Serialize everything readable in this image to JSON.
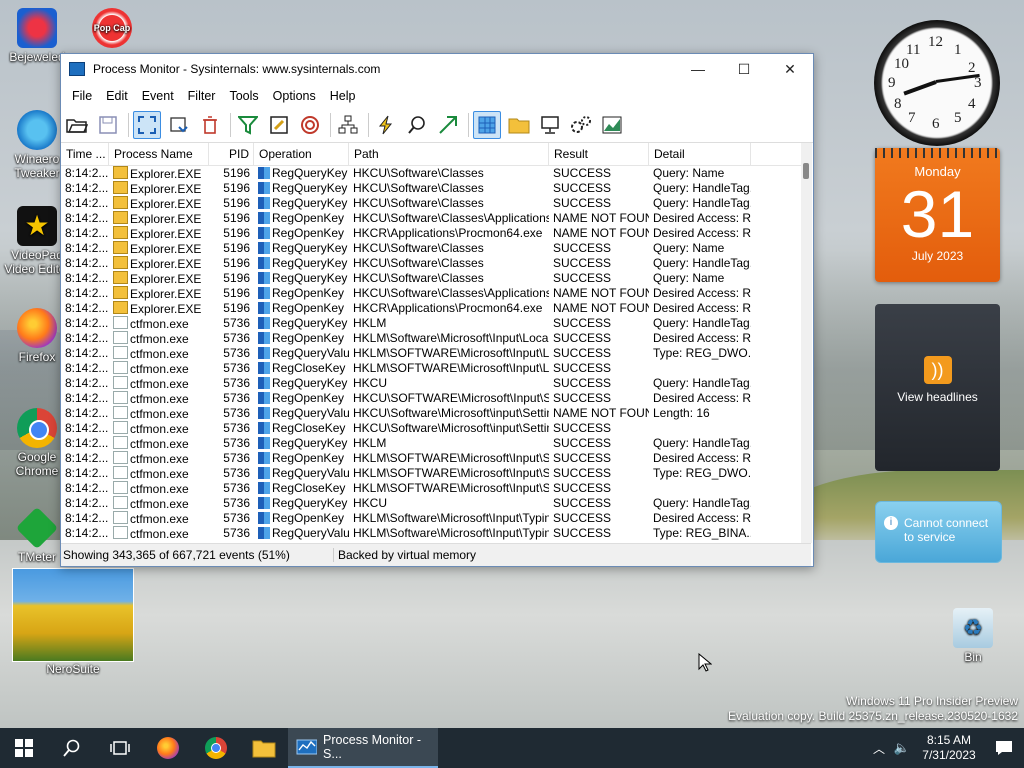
{
  "desktop": {
    "icons": [
      {
        "label": "Bejeweled"
      },
      {
        "label": "Winaero Tweaker"
      },
      {
        "label": "VideoPad Video Editor"
      },
      {
        "label": "Firefox"
      },
      {
        "label": "Google Chrome"
      },
      {
        "label": "TMeter"
      },
      {
        "label": "NeroSuite"
      },
      {
        "label": "Bin"
      }
    ],
    "popcap_label": "Pop Cap"
  },
  "window": {
    "title": "Process Monitor - Sysinternals: www.sysinternals.com",
    "menu": [
      "File",
      "Edit",
      "Event",
      "Filter",
      "Tools",
      "Options",
      "Help"
    ],
    "columns": [
      "Time ...",
      "Process Name",
      "PID",
      "Operation",
      "Path",
      "Result",
      "Detail"
    ],
    "rows": [
      [
        "8:14:2...",
        "Explorer.EXE",
        "5196",
        "RegQueryKey",
        "HKCU\\Software\\Classes",
        "SUCCESS",
        "Query: Name"
      ],
      [
        "8:14:2...",
        "Explorer.EXE",
        "5196",
        "RegQueryKey",
        "HKCU\\Software\\Classes",
        "SUCCESS",
        "Query: HandleTag..."
      ],
      [
        "8:14:2...",
        "Explorer.EXE",
        "5196",
        "RegQueryKey",
        "HKCU\\Software\\Classes",
        "SUCCESS",
        "Query: HandleTag..."
      ],
      [
        "8:14:2...",
        "Explorer.EXE",
        "5196",
        "RegOpenKey",
        "HKCU\\Software\\Classes\\Applications\\...",
        "NAME NOT FOUND",
        "Desired Access: R..."
      ],
      [
        "8:14:2...",
        "Explorer.EXE",
        "5196",
        "RegOpenKey",
        "HKCR\\Applications\\Procmon64.exe",
        "NAME NOT FOUND",
        "Desired Access: R..."
      ],
      [
        "8:14:2...",
        "Explorer.EXE",
        "5196",
        "RegQueryKey",
        "HKCU\\Software\\Classes",
        "SUCCESS",
        "Query: Name"
      ],
      [
        "8:14:2...",
        "Explorer.EXE",
        "5196",
        "RegQueryKey",
        "HKCU\\Software\\Classes",
        "SUCCESS",
        "Query: HandleTag..."
      ],
      [
        "8:14:2...",
        "Explorer.EXE",
        "5196",
        "RegQueryKey",
        "HKCU\\Software\\Classes",
        "SUCCESS",
        "Query: Name"
      ],
      [
        "8:14:2...",
        "Explorer.EXE",
        "5196",
        "RegOpenKey",
        "HKCU\\Software\\Classes\\Applications\\...",
        "NAME NOT FOUND",
        "Desired Access: R..."
      ],
      [
        "8:14:2...",
        "Explorer.EXE",
        "5196",
        "RegOpenKey",
        "HKCR\\Applications\\Procmon64.exe",
        "NAME NOT FOUND",
        "Desired Access: R..."
      ],
      [
        "8:14:2...",
        "ctfmon.exe",
        "5736",
        "RegQueryKey",
        "HKLM",
        "SUCCESS",
        "Query: HandleTag..."
      ],
      [
        "8:14:2...",
        "ctfmon.exe",
        "5736",
        "RegOpenKey",
        "HKLM\\Software\\Microsoft\\Input\\Locale...",
        "SUCCESS",
        "Desired Access: R..."
      ],
      [
        "8:14:2...",
        "ctfmon.exe",
        "5736",
        "RegQueryValue",
        "HKLM\\SOFTWARE\\Microsoft\\Input\\Lo...",
        "SUCCESS",
        "Type: REG_DWO..."
      ],
      [
        "8:14:2...",
        "ctfmon.exe",
        "5736",
        "RegCloseKey",
        "HKLM\\SOFTWARE\\Microsoft\\Input\\Lo...",
        "SUCCESS",
        ""
      ],
      [
        "8:14:2...",
        "ctfmon.exe",
        "5736",
        "RegQueryKey",
        "HKCU",
        "SUCCESS",
        "Query: HandleTag..."
      ],
      [
        "8:14:2...",
        "ctfmon.exe",
        "5736",
        "RegOpenKey",
        "HKCU\\SOFTWARE\\Microsoft\\Input\\Se...",
        "SUCCESS",
        "Desired Access: R..."
      ],
      [
        "8:14:2...",
        "ctfmon.exe",
        "5736",
        "RegQueryValue",
        "HKCU\\Software\\Microsoft\\input\\Setting...",
        "NAME NOT FOUND",
        "Length: 16"
      ],
      [
        "8:14:2...",
        "ctfmon.exe",
        "5736",
        "RegCloseKey",
        "HKCU\\Software\\Microsoft\\input\\Settings",
        "SUCCESS",
        ""
      ],
      [
        "8:14:2...",
        "ctfmon.exe",
        "5736",
        "RegQueryKey",
        "HKLM",
        "SUCCESS",
        "Query: HandleTag..."
      ],
      [
        "8:14:2...",
        "ctfmon.exe",
        "5736",
        "RegOpenKey",
        "HKLM\\SOFTWARE\\Microsoft\\Input\\Se...",
        "SUCCESS",
        "Desired Access: R..."
      ],
      [
        "8:14:2...",
        "ctfmon.exe",
        "5736",
        "RegQueryValue",
        "HKLM\\SOFTWARE\\Microsoft\\Input\\Se...",
        "SUCCESS",
        "Type: REG_DWO..."
      ],
      [
        "8:14:2...",
        "ctfmon.exe",
        "5736",
        "RegCloseKey",
        "HKLM\\SOFTWARE\\Microsoft\\Input\\Se...",
        "SUCCESS",
        ""
      ],
      [
        "8:14:2...",
        "ctfmon.exe",
        "5736",
        "RegQueryKey",
        "HKCU",
        "SUCCESS",
        "Query: HandleTag..."
      ],
      [
        "8:14:2...",
        "ctfmon.exe",
        "5736",
        "RegOpenKey",
        "HKLM\\Software\\Microsoft\\Input\\Typing...",
        "SUCCESS",
        "Desired Access: R..."
      ],
      [
        "8:14:2...",
        "ctfmon.exe",
        "5736",
        "RegQueryValue",
        "HKLM\\Software\\Microsoft\\Input\\Typing...",
        "SUCCESS",
        "Type: REG_BINA..."
      ]
    ],
    "status_events": "Showing 343,365 of 667,721 events (51%)",
    "status_memory": "Backed by virtual memory"
  },
  "gadgets": {
    "clock_numbers": [
      "12",
      "1",
      "2",
      "3",
      "4",
      "5",
      "6",
      "7",
      "8",
      "9",
      "10",
      "11"
    ],
    "calendar": {
      "weekday": "Monday",
      "day": "31",
      "month_year": "July 2023"
    },
    "feed": {
      "label": "View headlines"
    },
    "weather": {
      "message": "Cannot connect to service"
    }
  },
  "watermark": {
    "line1": "Windows 11 Pro Insider Preview",
    "line2": "Evaluation copy. Build 25375.zn_release.230520-1632"
  },
  "taskbar": {
    "active_task": "Process Monitor - S...",
    "time": "8:15 AM",
    "date": "7/31/2023"
  },
  "colors": {
    "accent": "#3b8de2",
    "taskbar": "#1f2a33"
  }
}
